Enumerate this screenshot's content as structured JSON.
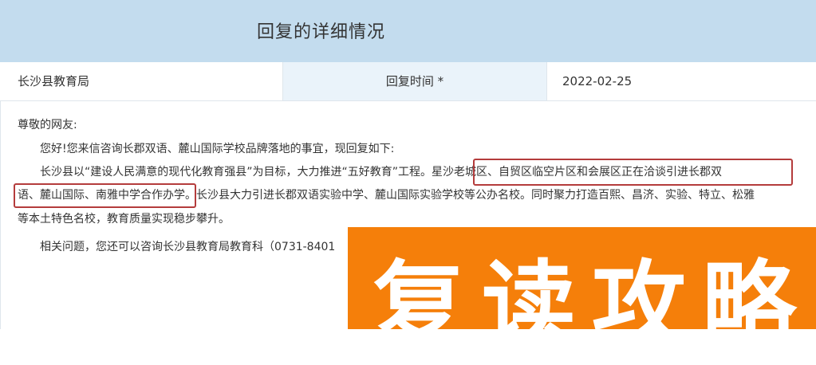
{
  "header": {
    "title": "回复的详细情况"
  },
  "info": {
    "department": "长沙县教育局",
    "time_label": "回复时间 *",
    "date": "2022-02-25"
  },
  "reply": {
    "greeting": "尊敬的网友:",
    "p1": "您好!您来信咨询长郡双语、麓山国际学校品牌落地的事宜，现回复如下:",
    "p2": "长沙县以“建设人民满意的现代化教育强县”为目标，大力推进“五好教育”工程。星沙老城区、自贸区临空片区和会展区正在洽谈引进长郡双",
    "p3": "语、麓山国际、南雅中学合作办学。长沙县大力引进长郡双语实验中学、麓山国际实验学校等公办名校。同时聚力打造百熙、昌济、实验、特立、松雅",
    "p4": "等本土特色名校，教育质量实现稳步攀升。",
    "p5": "相关问题，您还可以咨询长沙县教育局教育科（0731-8401"
  },
  "promo": {
    "text": "复读攻略",
    "bg": "#f57f0a"
  },
  "colors": {
    "header_bg": "#c3dcee",
    "label_bg": "#eaf3fa",
    "highlight": "#b43c3c"
  }
}
